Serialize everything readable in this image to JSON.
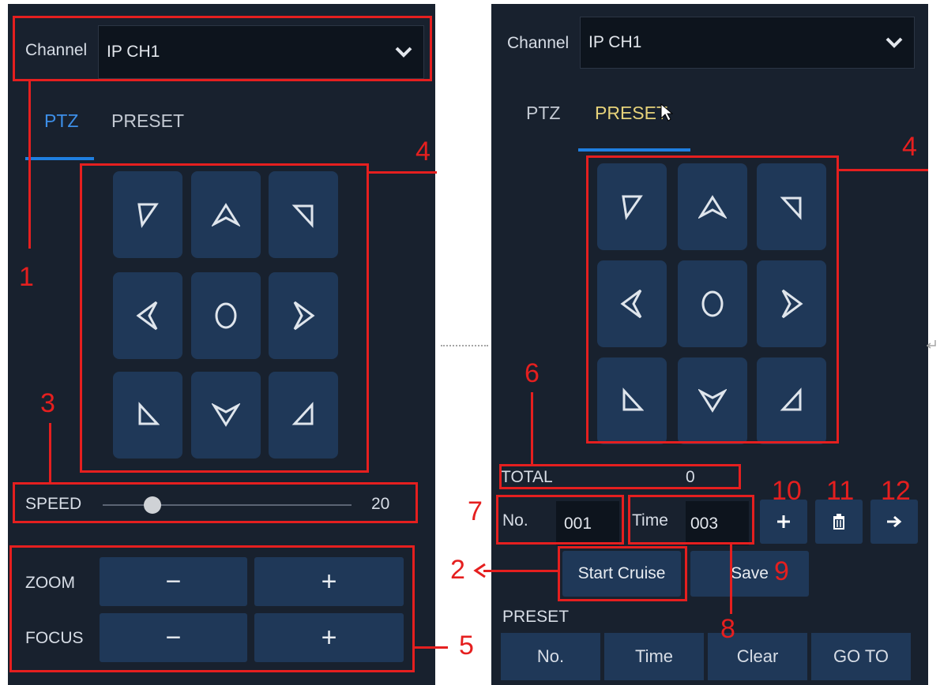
{
  "left_panel": {
    "channel_label": "Channel",
    "channel_value": "IP CH1",
    "tabs": [
      {
        "label": "PTZ",
        "active": true
      },
      {
        "label": "PRESET",
        "active": false
      }
    ],
    "speed": {
      "label": "SPEED",
      "value_text": "20",
      "level": 0.2
    },
    "zoom": {
      "label": "ZOOM",
      "minus": "−",
      "plus": "+"
    },
    "focus": {
      "label": "FOCUS",
      "minus": "−",
      "plus": "+"
    }
  },
  "right_panel": {
    "channel_label": "Channel",
    "channel_value": "IP CH1",
    "tabs": [
      {
        "label": "PTZ",
        "active": false
      },
      {
        "label": "PRESET",
        "active": true
      }
    ],
    "total_label": "TOTAL",
    "total_value": "0",
    "no_label": "No.",
    "no_value": "001",
    "time_label": "Time",
    "time_value": "003",
    "start_cruise": "Start Cruise",
    "save": "Save",
    "preset_heading": "PRESET",
    "table_headers": [
      "No.",
      "Time",
      "Clear",
      "GO TO"
    ]
  },
  "ptz_pad_icons": [
    "arrow-up-left-icon",
    "arrow-up-icon",
    "arrow-up-right-icon",
    "arrow-left-icon",
    "center-circle-icon",
    "arrow-right-icon",
    "arrow-down-left-icon",
    "arrow-down-icon",
    "arrow-down-right-icon"
  ],
  "callouts": [
    "1",
    "2",
    "3",
    "4",
    "4",
    "5",
    "6",
    "7",
    "8",
    "9",
    "10",
    "11",
    "12"
  ],
  "colors": {
    "panel_bg": "#18212e",
    "button_bg": "#1f3858",
    "accent_blue": "#1f7fe0",
    "active_tab_yellow": "#e6d27a",
    "annotation_red": "#e51f1f"
  }
}
